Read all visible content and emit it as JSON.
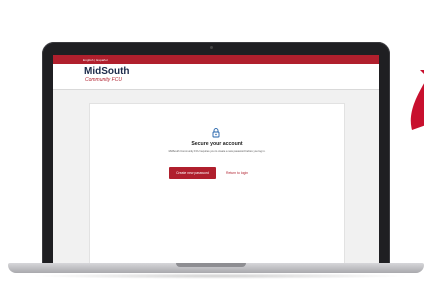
{
  "topbar": {
    "languages": "English | Español"
  },
  "logo": {
    "main": "MidSouth",
    "sub": "Community FCU"
  },
  "card": {
    "lock_icon": "lock-icon",
    "title": "Secure your account",
    "subtitle": "MidSouth Community FCU requires you to create a new password before you log in.",
    "primary_button": "Create new password",
    "secondary_link": "Return to login"
  },
  "colors": {
    "brand_red": "#b01f2d",
    "brand_navy": "#1b2a4a",
    "background": "#f1f1f1"
  }
}
